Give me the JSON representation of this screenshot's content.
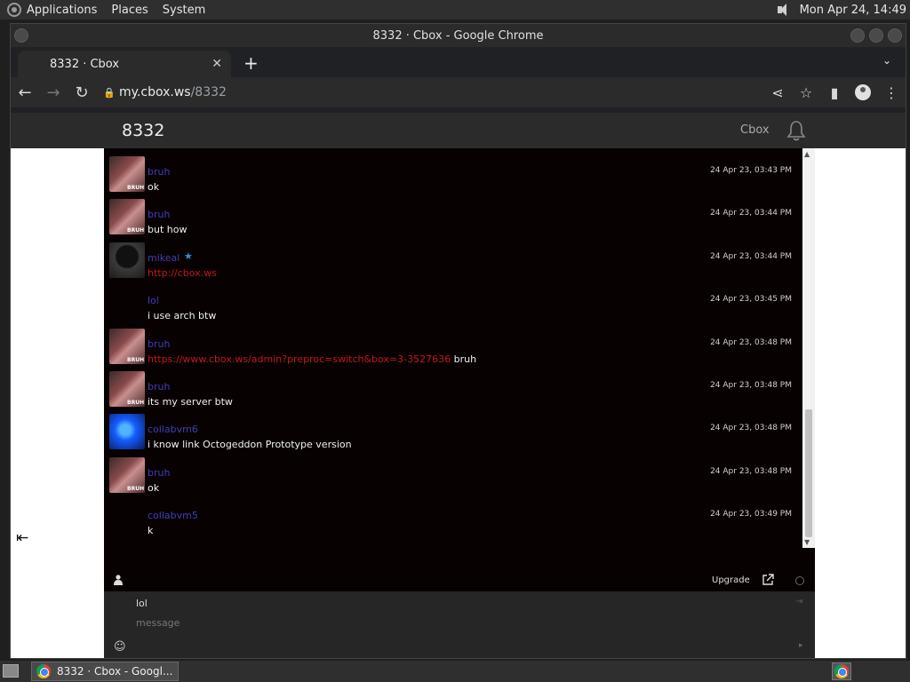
{
  "desktop": {
    "menus": [
      "Applications",
      "Places",
      "System"
    ],
    "clock": "Mon Apr 24, 14:49"
  },
  "browser": {
    "window_title": "8332 · Cbox - Google Chrome",
    "tab_title": "8332 · Cbox",
    "url_host": "my.cbox.ws",
    "url_path": "/8332"
  },
  "cbox": {
    "room_name": "8332",
    "brand": "Cbox",
    "messages": [
      {
        "user": "bruh",
        "text": "ok",
        "time": "24 Apr 23, 03:43 PM",
        "avatar": "bruh"
      },
      {
        "user": "bruh",
        "text": "but how",
        "time": "24 Apr 23, 03:44 PM",
        "avatar": "bruh"
      },
      {
        "user": "mikeal",
        "link": "http://cbox.ws",
        "time": "24 Apr 23, 03:44 PM",
        "avatar": "mikeal",
        "star": "★"
      },
      {
        "user": "lol",
        "text": "i use arch btw",
        "time": "24 Apr 23, 03:45 PM",
        "avatar": "none"
      },
      {
        "user": "bruh",
        "link": "https://www.cbox.ws/admin?preproc=switch&box=3-3527636",
        "text": " bruh",
        "time": "24 Apr 23, 03:48 PM",
        "avatar": "bruh"
      },
      {
        "user": "bruh",
        "text": "its my server btw",
        "time": "24 Apr 23, 03:48 PM",
        "avatar": "bruh"
      },
      {
        "user": "collabvm6",
        "text": "i know link Octogeddon Prototype version",
        "time": "24 Apr 23, 03:48 PM",
        "avatar": "coll"
      },
      {
        "user": "bruh",
        "text": "ok",
        "time": "24 Apr 23, 03:48 PM",
        "avatar": "bruh"
      },
      {
        "user": "collabvm5",
        "text": "k",
        "time": "24 Apr 23, 03:49 PM",
        "avatar": "none"
      }
    ],
    "footer": {
      "upgrade_label": "Upgrade",
      "name_value": "lol",
      "message_placeholder": "message"
    }
  },
  "taskbar": {
    "task_label": "8332 · Cbox - Googl..."
  },
  "colors": {
    "username": "#3e3eb6",
    "link": "#c21818",
    "chat_bg": "#080102"
  }
}
